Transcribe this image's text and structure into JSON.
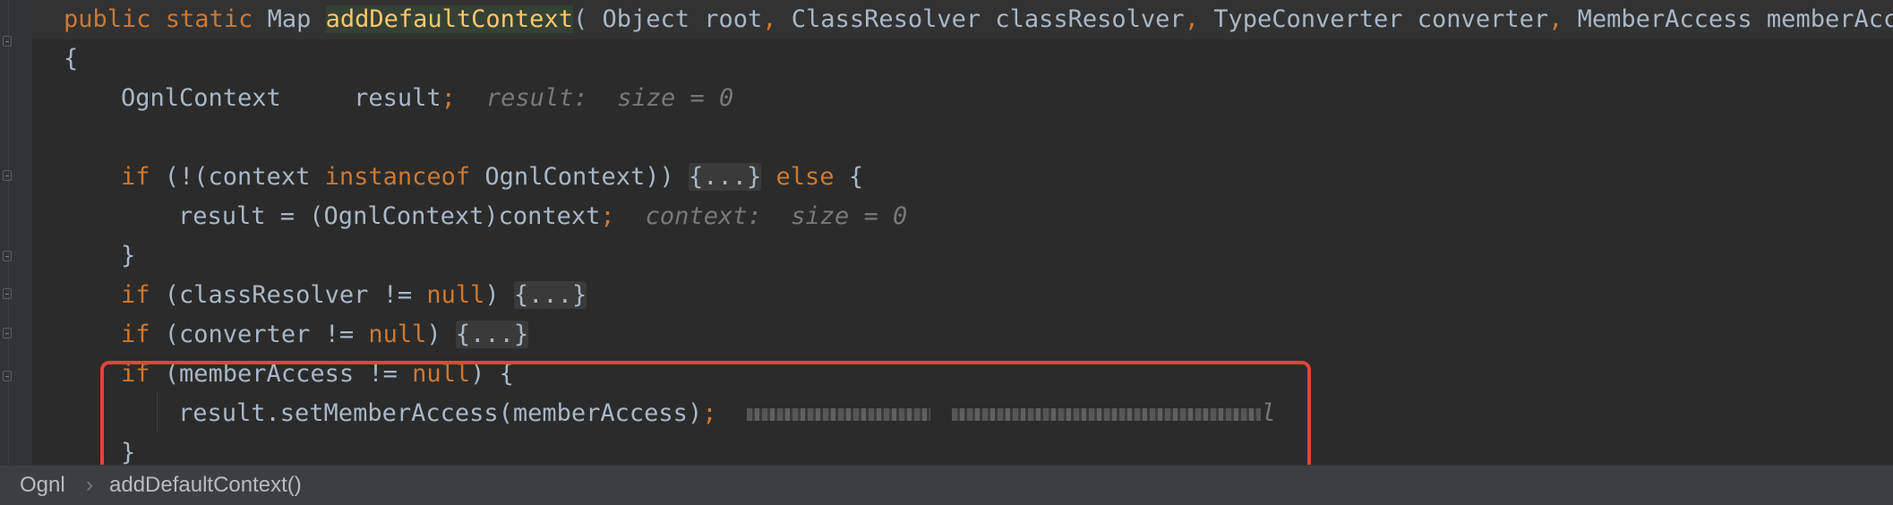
{
  "code": {
    "sig_mods": "public static ",
    "sig_type": "Map ",
    "sig_name": "addDefaultContext",
    "sig_p1": "( Object root",
    "sig_c1": ", ",
    "sig_p2": "ClassResolver classResolver",
    "sig_c2": ", ",
    "sig_p3": "TypeConverter converter",
    "sig_c3": ", ",
    "sig_p4": "MemberAccess memberAcce",
    "open_brace": "{",
    "decl_text": "OgnlContext     result",
    "decl_semi": ";",
    "decl_hint": "result:  size = 0",
    "if1_kw": "if",
    "if1_a": " (!(context ",
    "if1_kw2": "instanceof",
    "if1_b": " OgnlContext)) ",
    "if1_fold": "{...}",
    "if1_else": " else",
    "if1_c": " {",
    "assign_text": "result = (OgnlContext)context",
    "assign_semi": ";",
    "assign_hint": "context:  size = 0",
    "close1": "}",
    "if2_kw": "if",
    "if2_a": " (classResolver != ",
    "if2_null": "null",
    "if2_b": ") ",
    "if2_fold": "{...}",
    "if3_kw": "if",
    "if3_a": " (converter != ",
    "if3_null": "null",
    "if3_b": ") ",
    "if3_fold": "{...}",
    "if4_kw": "if",
    "if4_a": " (memberAccess != ",
    "if4_null": "null",
    "if4_b": ") {",
    "call_text": "result.setMemberAccess(memberAccess)",
    "call_semi": ";",
    "call_hint_tail": "l",
    "close2": "}"
  },
  "breadcrumb": {
    "class_name": "Ognl",
    "separator": "›",
    "method_name": "addDefaultContext()"
  }
}
